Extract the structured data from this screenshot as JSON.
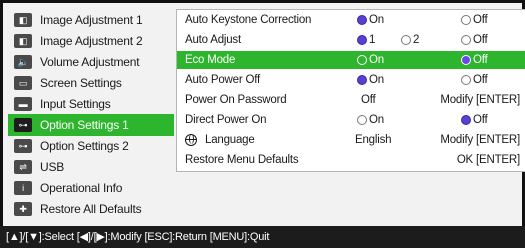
{
  "menu": {
    "items": [
      {
        "label": "Image Adjustment 1",
        "icon": "image-adjust-icon",
        "glyph": "◧",
        "selected": false
      },
      {
        "label": "Image Adjustment 2",
        "icon": "image-adjust-icon",
        "glyph": "◧",
        "selected": false
      },
      {
        "label": "Volume Adjustment",
        "icon": "speaker-icon",
        "glyph": "🔈",
        "selected": false
      },
      {
        "label": "Screen Settings",
        "icon": "screen-icon",
        "glyph": "▭",
        "selected": false
      },
      {
        "label": "Input Settings",
        "icon": "input-icon",
        "glyph": "▬",
        "selected": false
      },
      {
        "label": "Option Settings 1",
        "icon": "option-icon",
        "glyph": "⊶",
        "selected": true
      },
      {
        "label": "Option Settings 2",
        "icon": "option-icon",
        "glyph": "⊶",
        "selected": false
      },
      {
        "label": "USB",
        "icon": "usb-icon",
        "glyph": "⇌",
        "selected": false
      },
      {
        "label": "Operational Info",
        "icon": "info-icon",
        "glyph": "i",
        "selected": false
      },
      {
        "label": "Restore All Defaults",
        "icon": "restore-icon",
        "glyph": "✚",
        "selected": false
      }
    ]
  },
  "settings": {
    "rows": [
      {
        "label": "Auto Keystone Correction",
        "opt1": "On",
        "opt1_on": true,
        "opt3": "Off",
        "opt3_on": false
      },
      {
        "label": "Auto Adjust",
        "opt1": "1",
        "opt1_on": true,
        "opt2": "2",
        "opt2_on": false,
        "opt3": "Off",
        "opt3_on": false
      },
      {
        "label": "Eco Mode",
        "opt1": "On",
        "opt1_on": false,
        "opt3": "Off",
        "opt3_on": true,
        "highlight": true
      },
      {
        "label": "Auto Power Off",
        "opt1": "On",
        "opt1_on": true,
        "opt3": "Off",
        "opt3_on": false
      },
      {
        "label": "Power On Password",
        "value": "Off",
        "action": "Modify [ENTER]"
      },
      {
        "label": "Direct Power On",
        "opt1": "On",
        "opt1_on": false,
        "opt3": "Off",
        "opt3_on": true
      },
      {
        "label": "Language",
        "value": "English",
        "action": "Modify [ENTER]",
        "icon": "globe-icon"
      },
      {
        "label": "Restore Menu Defaults",
        "action": "OK [ENTER]"
      }
    ]
  },
  "footer": {
    "help": "[▲]/[▼]:Select [◀]/[▶]:Modify [ESC]:Return [MENU]:Quit"
  },
  "colors": {
    "highlight": "#2db52d",
    "radio_on": "#5a3fd0",
    "footer_bg": "#1c1c1c"
  }
}
